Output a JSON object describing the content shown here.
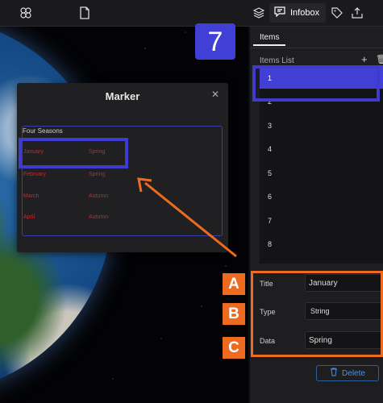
{
  "toolbar": {
    "icons": [
      "cesium-logo-icon",
      "file-icon",
      "layers-icon",
      "infobox-icon",
      "tag-icon",
      "share-icon"
    ],
    "infobox_label": "Infobox"
  },
  "panel": {
    "tab_label": "Items",
    "items_list_label": "Items List",
    "items": [
      "1",
      "2",
      "3",
      "4",
      "5",
      "6",
      "7",
      "8"
    ],
    "selected_index": 0,
    "fields": {
      "title_label": "Title",
      "title_value": "January",
      "type_label": "Type",
      "type_value": "String",
      "data_label": "Data",
      "data_value": "Spring"
    },
    "delete_label": "Delete"
  },
  "marker": {
    "title": "Marker",
    "box_title": "Four Seasons",
    "rows": [
      {
        "month": "January",
        "season": "Spring"
      },
      {
        "month": "February",
        "season": "Spring"
      },
      {
        "month": "March",
        "season": "Autumn"
      },
      {
        "month": "April",
        "season": "Autumn"
      }
    ]
  },
  "annotations": {
    "step_number": "7",
    "letters": [
      "A",
      "B",
      "C"
    ],
    "accent_blue": "#4140d6",
    "accent_orange": "#ee6a20"
  }
}
